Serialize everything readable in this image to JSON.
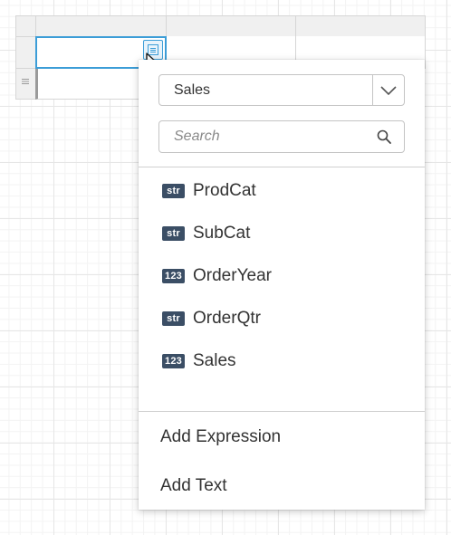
{
  "popup": {
    "dataset": {
      "selected": "Sales"
    },
    "search": {
      "placeholder": "Search",
      "value": ""
    },
    "fields": [
      {
        "type_badge": "str",
        "name": "ProdCat"
      },
      {
        "type_badge": "str",
        "name": "SubCat"
      },
      {
        "type_badge": "123",
        "name": "OrderYear"
      },
      {
        "type_badge": "str",
        "name": "OrderQtr"
      },
      {
        "type_badge": "123",
        "name": "Sales"
      }
    ],
    "actions": {
      "add_expression": "Add Expression",
      "add_text": "Add Text"
    }
  },
  "icons": {
    "field_picker": "field-list-icon",
    "dropdown": "chevron-down-icon",
    "search": "search-icon",
    "row_handle": "drag-handle-icon",
    "cursor": "mouse-pointer-icon"
  },
  "colors": {
    "selection_border": "#3c9dd7",
    "type_badge_bg": "#3b4e65",
    "text": "#333333"
  }
}
